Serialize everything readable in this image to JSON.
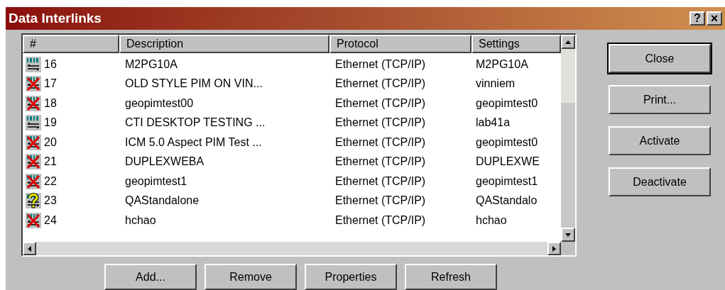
{
  "window": {
    "title": "Data Interlinks",
    "help_button": "?",
    "close_button": "×"
  },
  "table": {
    "columns": [
      "#",
      "Description",
      "Protocol",
      "Settings"
    ],
    "rows": [
      {
        "kind": "active",
        "number": "16",
        "description": "M2PG10A",
        "protocol": "Ethernet (TCP/IP)",
        "settings": "M2PG10A"
      },
      {
        "kind": "inactive",
        "number": "17",
        "description": "OLD STYLE PIM ON VIN...",
        "protocol": "Ethernet (TCP/IP)",
        "settings": "vinniem"
      },
      {
        "kind": "inactive",
        "number": "18",
        "description": "geopimtest00",
        "protocol": "Ethernet (TCP/IP)",
        "settings": "geopimtest0"
      },
      {
        "kind": "active",
        "number": "19",
        "description": "CTI DESKTOP TESTING ...",
        "protocol": "Ethernet (TCP/IP)",
        "settings": "lab41a"
      },
      {
        "kind": "inactive",
        "number": "20",
        "description": "ICM 5.0 Aspect PIM Test ...",
        "protocol": "Ethernet (TCP/IP)",
        "settings": "geopimtest0"
      },
      {
        "kind": "inactive",
        "number": "21",
        "description": "DUPLEXWEBA",
        "protocol": "Ethernet (TCP/IP)",
        "settings": "DUPLEXWE"
      },
      {
        "kind": "inactive",
        "number": "22",
        "description": "geopimtest1",
        "protocol": "Ethernet (TCP/IP)",
        "settings": "geopimtest1"
      },
      {
        "kind": "unknown",
        "number": "23",
        "description": "QAStandalone",
        "protocol": "Ethernet (TCP/IP)",
        "settings": "QAStandalo"
      },
      {
        "kind": "inactive",
        "number": "24",
        "description": "hchao",
        "protocol": "Ethernet (TCP/IP)",
        "settings": "hchao"
      }
    ]
  },
  "side_buttons": [
    {
      "label": "Close",
      "default": true
    },
    {
      "label": "Print...",
      "default": false
    },
    {
      "label": "Activate",
      "default": false
    },
    {
      "label": "Deactivate",
      "default": false
    }
  ],
  "bottom_buttons": [
    "Add...",
    "Remove",
    "Properties",
    "Refresh"
  ]
}
